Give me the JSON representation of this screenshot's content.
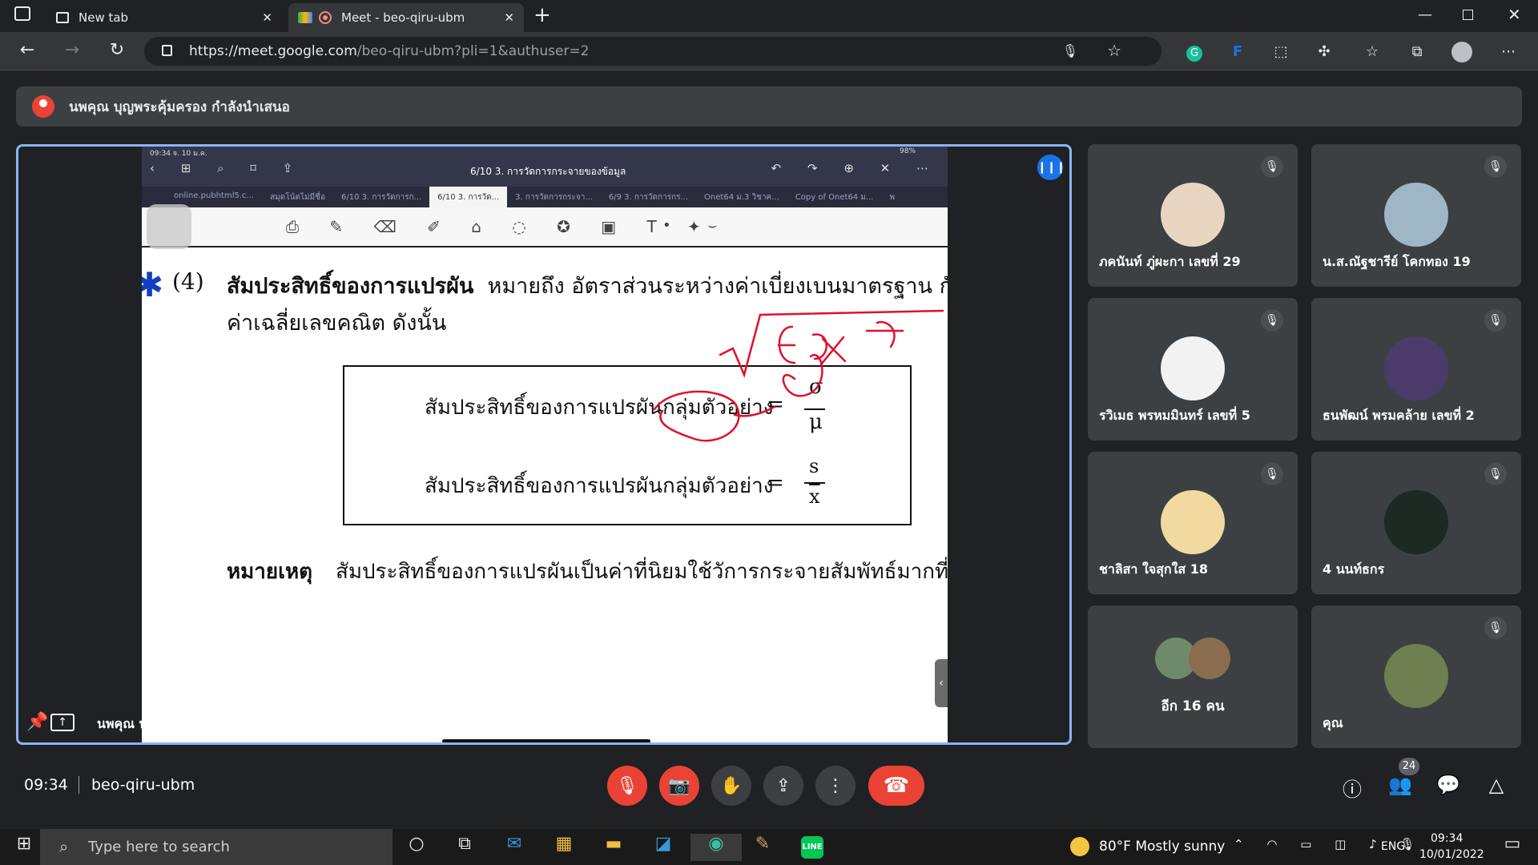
{
  "browser": {
    "tabs": [
      {
        "title": "New tab"
      },
      {
        "title": "Meet - beo-qiru-ubm"
      }
    ],
    "url_host": "https://meet.google.com",
    "url_path": "/beo-qiru-ubm?pli=1&authuser=2"
  },
  "banner": {
    "text": "นพคุณ บุญพระคุ้มครอง กำลังนำเสนอ"
  },
  "presentation": {
    "ipad_status_time": "09:34 จ. 10 ม.ค.",
    "ipad_status_right": "98%",
    "doc_title": "6/10 3. การวัดการกระจายของข้อมูล",
    "doc_tabs": [
      "online.pubhtml5.c...",
      "สมุดโน้ตไม่มีชื่อ",
      "6/10 3. การวัดการก...",
      "6/10 3. การวัด...",
      "3. การวัดการกระจา...",
      "6/9 3. การวัดการกร...",
      "Onet64 ม.3 วิชาค...",
      "Copy of Onet64 ม...",
      "พ"
    ],
    "heading_num": "(4)",
    "heading_bold": "สัมประสิทธิ์ของการแปรผัน",
    "heading_rest": "หมายถึง  อัตราส่วนระหว่างค่าเบี่ยงเบนมาตรฐาน กับ",
    "heading_line2": "ค่าเฉลี่ยเลขคณิต  ดังนั้น",
    "formula1_label": "สัมประสิทธิ์ของการแปรผันกลุ่มตัวอย่าง",
    "formula1_num": "σ",
    "formula1_den": "μ",
    "formula2_label": "สัมประสิทธิ์ของการแปรผันกลุ่มตัวอย่าง",
    "formula2_num": "s",
    "formula2_den": "x",
    "equals": "=",
    "note_label": "หมายเหตุ",
    "note_text": "สัมประสิทธิ์ของการแปรผันเป็นค่าที่นิยมใช้วัการกระจายสัมพัทธ์มากที่สุด",
    "presenter_caption": "นพคุณ บุญพระคุ้มครอง"
  },
  "participants": [
    {
      "name": "ภคนันท์ ภู่ผะกา เลขที่ 29",
      "muted": true,
      "avatar_color": "#e9d6c0"
    },
    {
      "name": "น.ส.ณัฐชารีย์ โคกทอง 19",
      "muted": true,
      "avatar_color": "#9fb6c6"
    },
    {
      "name": "รวิเมธ พรหมมินทร์ เลขที่ 5",
      "muted": true,
      "avatar_color": "#f2f2f2"
    },
    {
      "name": "ธนพัฒน์ พรมคล้าย เลขที่ 2",
      "muted": true,
      "avatar_color": "#4b3b6b"
    },
    {
      "name": "ชาลิสา ใจสุกใส 18",
      "muted": true,
      "avatar_color": "#f1d9a0"
    },
    {
      "name": "4 นนท์ธกร",
      "muted": true,
      "avatar_color": "#1d2a24"
    },
    {
      "name": "อีก 16 คน",
      "muted": false,
      "avatar_color": "#6f8a6a"
    },
    {
      "name": "คุณ",
      "muted": true,
      "avatar_color": "#6f7f4f"
    }
  ],
  "meeting": {
    "time": "09:34",
    "code": "beo-qiru-ubm",
    "people_count": "24"
  },
  "taskbar": {
    "search_placeholder": "Type here to search",
    "weather": "80°F  Mostly sunny",
    "lang": "ENG",
    "clock_time": "09:34",
    "clock_date": "10/01/2022"
  }
}
